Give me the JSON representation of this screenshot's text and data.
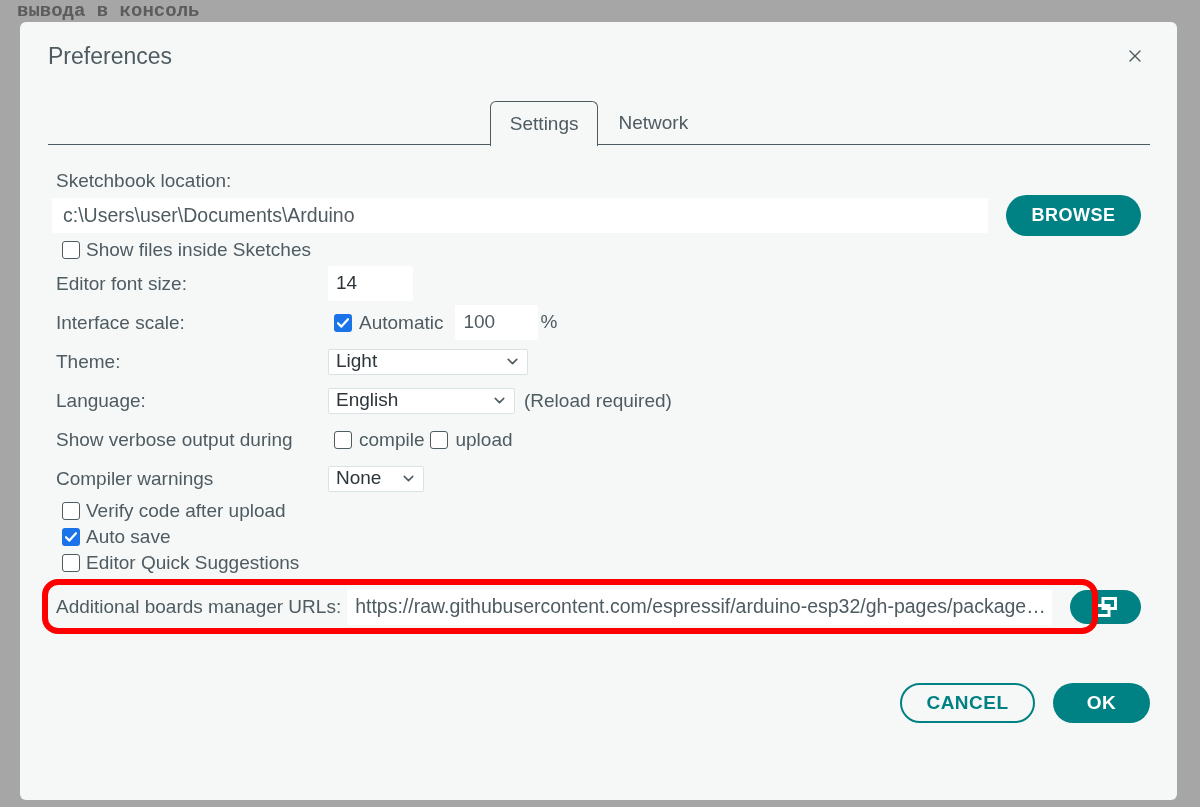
{
  "background": {
    "text": "вывода в консоль"
  },
  "dialog": {
    "title": "Preferences"
  },
  "tabs": [
    {
      "label": "Settings",
      "selected": true
    },
    {
      "label": "Network",
      "selected": false
    }
  ],
  "settings": [
    {
      "kind": "path",
      "label": "Sketchbook location:",
      "value": "c:\\Users\\user\\Documents\\Arduino",
      "button": "BROWSE"
    },
    {
      "kind": "checkbox",
      "label": "Show files inside Sketches",
      "checked": false
    },
    {
      "kind": "number",
      "label": "Editor font size:",
      "value": "14"
    },
    {
      "kind": "scale",
      "label": "Interface scale:",
      "option": "Automatic",
      "checked": true,
      "value": "100",
      "unit": "%"
    },
    {
      "kind": "select",
      "label": "Theme:",
      "value": "Light"
    },
    {
      "kind": "select",
      "label": "Language:",
      "value": "English",
      "note": "(Reload required)"
    },
    {
      "kind": "checkgroup",
      "label": "Show verbose output during",
      "options": [
        {
          "label": "compile",
          "checked": false
        },
        {
          "label": "upload",
          "checked": false
        }
      ]
    },
    {
      "kind": "select",
      "label": "Compiler warnings",
      "value": "None"
    },
    {
      "kind": "checkbox",
      "label": "Verify code after upload",
      "checked": false
    },
    {
      "kind": "checkbox",
      "label": "Auto save",
      "checked": true
    },
    {
      "kind": "checkbox",
      "label": "Editor Quick Suggestions",
      "checked": false
    },
    {
      "kind": "urls",
      "label": "Additional boards manager URLs:",
      "value": "https://raw.githubusercontent.com/espressif/arduino-esp32/gh-pages/package…",
      "highlighted": true
    }
  ],
  "buttons": [
    {
      "label": "CANCEL",
      "kind": "secondary"
    },
    {
      "label": "OK",
      "kind": "primary"
    }
  ]
}
